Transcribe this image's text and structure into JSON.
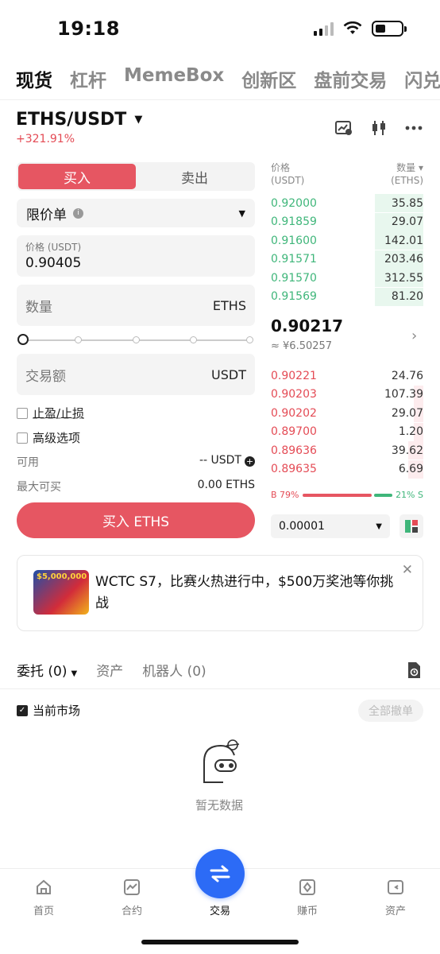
{
  "status": {
    "time": "19:18"
  },
  "top_tabs": [
    "现货",
    "杠杆",
    "MemeBox",
    "创新区",
    "盘前交易",
    "闪兑"
  ],
  "pair": {
    "name": "ETHS/USDT",
    "change": "+321.91%"
  },
  "trade": {
    "buy_label": "买入",
    "sell_label": "卖出",
    "order_type": "限价单",
    "price_label": "价格 (USDT)",
    "price_value": "0.90405",
    "qty_placeholder": "数量",
    "qty_unit": "ETHS",
    "amount_placeholder": "交易额",
    "amount_unit": "USDT",
    "tp_sl": "止盈/止损",
    "advanced": "高级选项",
    "available_label": "可用",
    "available_value": "-- USDT",
    "max_buy_label": "最大可买",
    "max_buy_value": "0.00 ETHS",
    "buy_button": "买入 ETHS"
  },
  "orderbook": {
    "price_header": "价格",
    "price_unit": "(USDT)",
    "qty_header": "数量 ▾",
    "qty_unit": "(ETHS)",
    "asks": [
      {
        "price": "0.92000",
        "qty": "35.85",
        "depth": 0.32
      },
      {
        "price": "0.91859",
        "qty": "29.07",
        "depth": 0.32
      },
      {
        "price": "0.91600",
        "qty": "142.01",
        "depth": 0.32
      },
      {
        "price": "0.91571",
        "qty": "203.46",
        "depth": 0.32
      },
      {
        "price": "0.91570",
        "qty": "312.55",
        "depth": 0.32
      },
      {
        "price": "0.91569",
        "qty": "81.20",
        "depth": 0.32
      }
    ],
    "last_price": "0.90217",
    "last_cny": "≈ ¥6.50257",
    "bids": [
      {
        "price": "0.90221",
        "qty": "24.76",
        "depth": 0.0
      },
      {
        "price": "0.90203",
        "qty": "107.39",
        "depth": 0.06
      },
      {
        "price": "0.90202",
        "qty": "29.07",
        "depth": 0.06
      },
      {
        "price": "0.89700",
        "qty": "1.20",
        "depth": 0.06
      },
      {
        "price": "0.89636",
        "qty": "39.62",
        "depth": 0.1
      },
      {
        "price": "0.89635",
        "qty": "6.69",
        "depth": 0.1
      }
    ],
    "buy_ratio_label": "B 79%",
    "sell_ratio_label": "21% S",
    "buy_ratio": 0.79,
    "precision": "0.00001"
  },
  "banner": {
    "image_text": "$5,000,000",
    "text": "WCTC S7，比赛火热进行中，$500万奖池等你挑战"
  },
  "orders": {
    "tab_orders": "委托 (0)",
    "tab_assets": "资产",
    "tab_bots": "机器人 (0)",
    "current_market": "当前市场",
    "cancel_all": "全部撤单",
    "empty": "暂无数据"
  },
  "nav": [
    "首页",
    "合约",
    "交易",
    "赚币",
    "资产"
  ],
  "colors": {
    "buy": "#e65662",
    "sell": "#3fb67a",
    "accent": "#2c6bf6"
  }
}
